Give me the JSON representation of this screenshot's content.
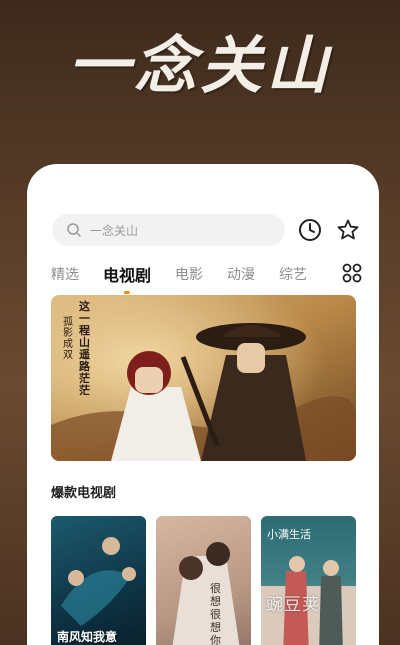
{
  "hero": {
    "title": "一念关山"
  },
  "search": {
    "placeholder": "一念关山"
  },
  "tabs": [
    {
      "label": "精选"
    },
    {
      "label": "电视剧"
    },
    {
      "label": "电影"
    },
    {
      "label": "动漫"
    },
    {
      "label": "综艺"
    }
  ],
  "active_tab": "电视剧",
  "banner": {
    "poem_line1": "这一程山遥路茫茫",
    "poem_line2": "孤影成双"
  },
  "section": {
    "title": "爆款电视剧"
  },
  "cards": [
    {
      "title": "南风知我意"
    },
    {
      "title": "很想很想你"
    },
    {
      "title": "小满生活"
    }
  ],
  "watermark": "豌豆荚",
  "colors": {
    "accent": "#ff8a00",
    "background": "#5a3e29"
  }
}
